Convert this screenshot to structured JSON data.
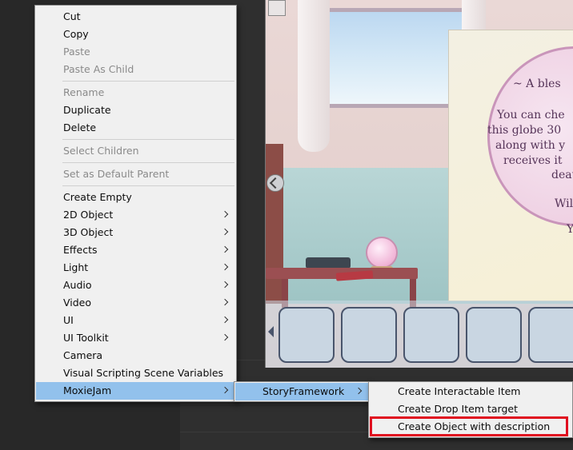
{
  "context_menu": {
    "items": [
      {
        "label": "Cut"
      },
      {
        "label": "Copy"
      },
      {
        "label": "Paste"
      },
      {
        "label": "Paste As Child"
      },
      {
        "label": "Rename"
      },
      {
        "label": "Duplicate"
      },
      {
        "label": "Delete"
      },
      {
        "label": "Select Children"
      },
      {
        "label": "Set as Default Parent"
      },
      {
        "label": "Create Empty"
      },
      {
        "label": "2D Object"
      },
      {
        "label": "3D Object"
      },
      {
        "label": "Effects"
      },
      {
        "label": "Light"
      },
      {
        "label": "Audio"
      },
      {
        "label": "Video"
      },
      {
        "label": "UI"
      },
      {
        "label": "UI Toolkit"
      },
      {
        "label": "Camera"
      },
      {
        "label": "Visual Scripting Scene Variables"
      },
      {
        "label": "MoxieJam"
      }
    ]
  },
  "submenu_moxiejam": {
    "items": [
      {
        "label": "StoryFramework"
      }
    ]
  },
  "submenu_storyframework": {
    "items": [
      {
        "label": "Create Interactable Item"
      },
      {
        "label": "Create Drop Item target"
      },
      {
        "label": "Create Object with description"
      }
    ]
  },
  "game_view": {
    "description_lines": [
      "~ A bles",
      "You can che",
      "this globe 30",
      "along with y",
      "receives it",
      "death",
      "Will",
      "Y"
    ]
  },
  "colors": {
    "menu_bg": "#f0f0f0",
    "menu_highlight": "#92c1ec",
    "annotation_box": "#e00e1f",
    "disabled_text": "#8a8a8a"
  }
}
